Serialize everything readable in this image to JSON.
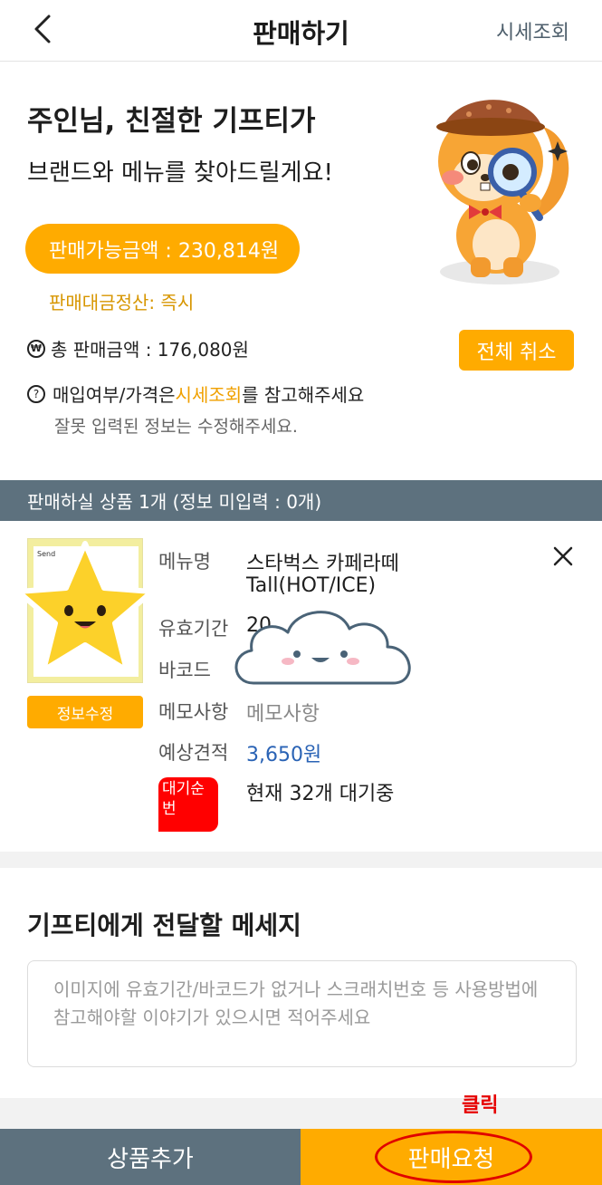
{
  "header": {
    "title": "판매하기",
    "right_link": "시세조회",
    "back_icon": "chevron-left-icon"
  },
  "intro": {
    "title": "주인님, 친절한 기프티가",
    "subtitle": "브랜드와 메뉴를 찾아드릴게요!",
    "available_amount": "판매가능금액 : 230,814원",
    "settlement": "판매대금정산: 즉시",
    "total_sale": "총 판매금액 : 176,080원",
    "cancel_all": "전체 취소",
    "info_prefix": "매입여부/가격은 ",
    "info_link": "시세조회",
    "info_suffix": "를 참고해주세요",
    "info_sub": "잘못 입력된 정보는 수정해주세요."
  },
  "banner": {
    "text": "판매하실 상품 1개 (정보 미입력 : 0개)"
  },
  "product": {
    "thumb_brand": "Send",
    "edit_button": "정보수정",
    "rows": {
      "menu_label": "메뉴명",
      "menu_value_line1": "스타벅스 카페라떼",
      "menu_value_line2": "Tall(HOT/ICE)",
      "expiry_label": "유효기간",
      "expiry_value": "20",
      "barcode_label": "바코드",
      "memo_label": "메모사항",
      "memo_placeholder": "메모사항",
      "estimate_label": "예상견적",
      "estimate_value": "3,650원",
      "queue_label": "대기순번",
      "queue_value": "현재 32개 대기중"
    }
  },
  "message": {
    "title": "기프티에게 전달할 메세지",
    "placeholder": "이미지에 유효기간/바코드가 없거나 스크래치번호 등 사용방법에 참고해야할 이야기가 있으시면 적어주세요"
  },
  "annotation": {
    "click_note": "클릭"
  },
  "bottom": {
    "add_button": "상품추가",
    "sell_button": "판매요청"
  },
  "colors": {
    "accent": "#ffab00",
    "slate": "#5d717e",
    "link_blue": "#2a63b5",
    "annotation_red": "#e60000"
  }
}
